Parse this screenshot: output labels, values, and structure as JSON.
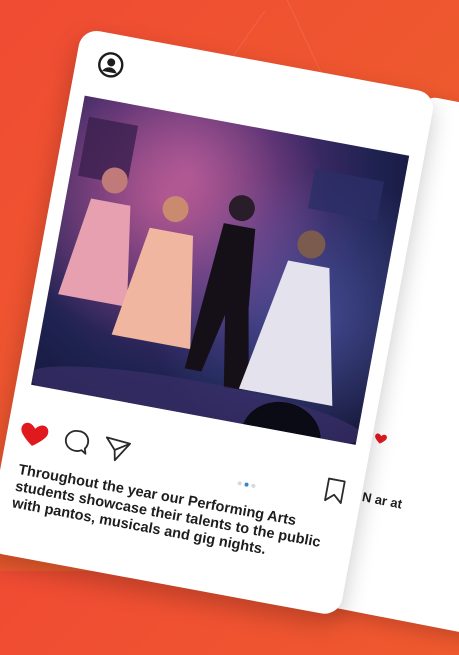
{
  "colors": {
    "background": "#f05131",
    "card": "#ffffff",
    "heart": "#e0191f",
    "active_dot": "#2f87d0",
    "text": "#1d1d1d"
  },
  "post": {
    "profile_icon": "user-circle-icon",
    "more_icon": "more-vertical-icon",
    "photo_alt": "",
    "actions": {
      "like_icon": "heart-icon",
      "comment_icon": "comment-bubble-icon",
      "share_icon": "send-icon",
      "bookmark_icon": "bookmark-icon"
    },
    "carousel_index": 2,
    "carousel_total": 3,
    "caption": "Throughout the year our Performing Arts students showcase their talents to the public with pantos, musicals and gig nights."
  },
  "side_card": {
    "caption": "N ar at"
  }
}
